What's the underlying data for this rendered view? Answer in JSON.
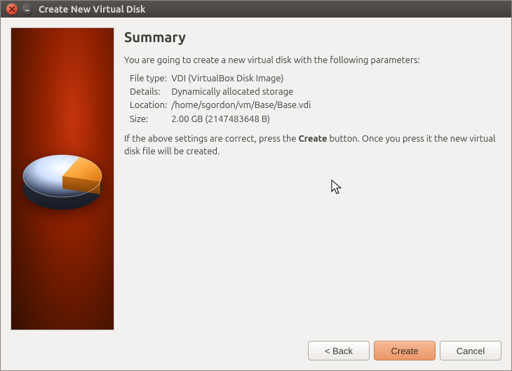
{
  "titlebar": {
    "title": "Create New Virtual Disk"
  },
  "heading": "Summary",
  "intro": "You are going to create a new virtual disk with the following parameters:",
  "params": {
    "file_type_label": "File type:",
    "file_type_value": "VDI (VirtualBox Disk Image)",
    "details_label": "Details:",
    "details_value": "Dynamically allocated storage",
    "location_label": "Location:",
    "location_value": "/home/sgordon/vm/Base/Base.vdi",
    "size_label": "Size:",
    "size_value": "2.00 GB (2147483648 B)"
  },
  "outro_pre": "If the above settings are correct, press the ",
  "outro_bold": "Create",
  "outro_post": " button. Once you press it the new virtual disk file will be created.",
  "buttons": {
    "back": "< Back",
    "create": "Create",
    "cancel": "Cancel"
  },
  "icons": {
    "close": "close-icon",
    "minimize": "minimize-icon"
  }
}
